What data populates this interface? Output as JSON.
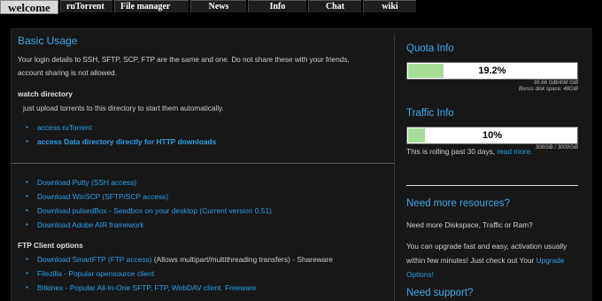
{
  "nav": {
    "tabs": [
      {
        "label": "welcome",
        "active": true
      },
      {
        "label": "ruTorrent"
      },
      {
        "label": "File manager"
      },
      {
        "label": "News"
      },
      {
        "label": "Info"
      },
      {
        "label": "Chat"
      },
      {
        "label": "wiki"
      }
    ]
  },
  "basic": {
    "title": "Basic Usage",
    "intro_line1": "Your login details to SSH, SFTP, SCP, FTP are the same and one. Do not share these with your friends,",
    "intro_line2": "account sharing is not allowed.",
    "watch_title": "watch directory",
    "watch_text": "just upload torrents to this directory to start them automatically.",
    "link_rutorrent": "access ruTorrent",
    "link_data": "access Data directory directly for HTTP downloads"
  },
  "downloads": {
    "putty": "Download Putty (SSH access)",
    "winscp": "Download WinSCP (SFTP/SCP access)",
    "pulsedbox": "Download pulsedBox - Seedbox on your desktop (Current version 0.51)",
    "air": "Download Adobe AIR framework"
  },
  "ftp": {
    "title": "FTP Client options",
    "smartftp_link": "Download SmartFTP (FTP access)",
    "smartftp_rest": " (Allows multipart/multithreading transfers) - Shareware",
    "filezilla": "Filezilla - Popular opensource client",
    "bitkinex": "Bitkinex - Popular All-In-One SFTP, FTP, WebDAV client. Freeware"
  },
  "quota": {
    "title": "Quota Info",
    "percent_label": "19.2%",
    "fraction": 0.192,
    "detail1": "95.66 GiB/498 GiB",
    "detail2": "Bonus disk space: 48GiB"
  },
  "traffic": {
    "title": "Traffic Info",
    "percent_label": "10%",
    "fraction": 0.1,
    "detail": "308GiB / 3000GiB",
    "note_prefix": "This is rolling past 30 days, ",
    "note_link": "read more."
  },
  "resources": {
    "title": "Need more resources?",
    "text1": "Need more Diskspace, Traffic or Ram?",
    "text2": "You can upgrade fast and easy, activation usually within few minutes! Just check out Your ",
    "link": "Upgrade Options!"
  },
  "support": {
    "title": "Need support?"
  },
  "colors": {
    "accent": "#2e9fe6",
    "meter_fill": "#a6dd97",
    "panel_bg": "#171717"
  }
}
